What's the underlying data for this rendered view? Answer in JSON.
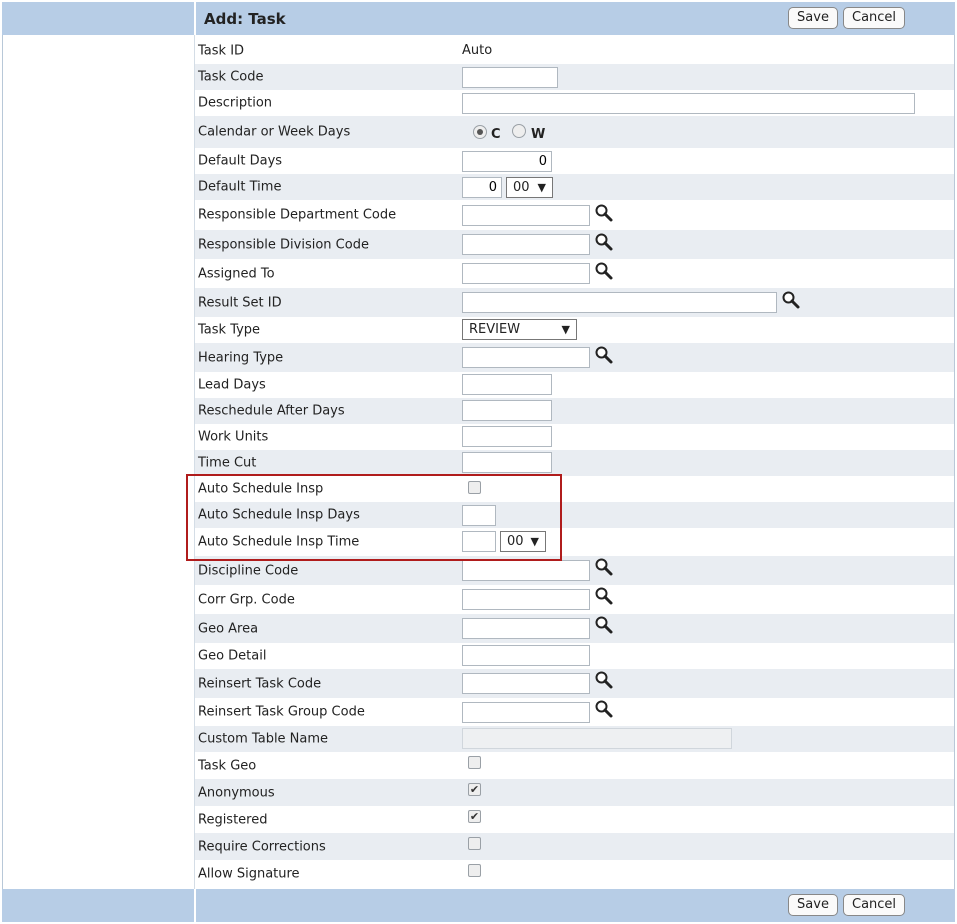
{
  "header": {
    "title": "Add: Task",
    "save_label": "Save",
    "cancel_label": "Cancel"
  },
  "footer": {
    "save_label": "Save",
    "cancel_label": "Cancel"
  },
  "form": {
    "task_id": {
      "label": "Task ID",
      "value": "Auto"
    },
    "task_code": {
      "label": "Task Code",
      "value": ""
    },
    "description": {
      "label": "Description",
      "value": ""
    },
    "calendar_or_week": {
      "label": "Calendar or Week Days",
      "option_c": "C",
      "option_w": "W",
      "selected": "C"
    },
    "default_days": {
      "label": "Default Days",
      "value": "0"
    },
    "default_time": {
      "label": "Default Time",
      "hours": "0",
      "minutes": "00"
    },
    "responsible_department_code": {
      "label": "Responsible Department Code",
      "value": ""
    },
    "responsible_division_code": {
      "label": "Responsible Division Code",
      "value": ""
    },
    "assigned_to": {
      "label": "Assigned To",
      "value": ""
    },
    "result_set_id": {
      "label": "Result Set ID",
      "value": ""
    },
    "task_type": {
      "label": "Task Type",
      "value": "REVIEW"
    },
    "hearing_type": {
      "label": "Hearing Type",
      "value": ""
    },
    "lead_days": {
      "label": "Lead Days",
      "value": ""
    },
    "reschedule_after_days": {
      "label": "Reschedule After Days",
      "value": ""
    },
    "work_units": {
      "label": "Work Units",
      "value": ""
    },
    "time_cut": {
      "label": "Time Cut",
      "value": ""
    },
    "auto_schedule_insp": {
      "label": "Auto Schedule Insp",
      "checked": false
    },
    "auto_schedule_insp_days": {
      "label": "Auto Schedule Insp Days",
      "value": ""
    },
    "auto_schedule_insp_time": {
      "label": "Auto Schedule Insp Time",
      "hours": "",
      "minutes": "00"
    },
    "discipline_code": {
      "label": "Discipline Code",
      "value": ""
    },
    "corr_grp_code": {
      "label": "Corr Grp. Code",
      "value": ""
    },
    "geo_area": {
      "label": "Geo Area",
      "value": ""
    },
    "geo_detail": {
      "label": "Geo Detail",
      "value": ""
    },
    "reinsert_task_code": {
      "label": "Reinsert Task Code",
      "value": ""
    },
    "reinsert_task_group_code": {
      "label": "Reinsert Task Group Code",
      "value": ""
    },
    "custom_table_name": {
      "label": "Custom Table Name",
      "value": ""
    },
    "task_geo": {
      "label": "Task Geo",
      "checked": false
    },
    "anonymous": {
      "label": "Anonymous",
      "checked": true
    },
    "registered": {
      "label": "Registered",
      "checked": true
    },
    "require_corrections": {
      "label": "Require Corrections",
      "checked": false
    },
    "allow_signature": {
      "label": "Allow Signature",
      "checked": false
    }
  },
  "icons": {
    "lookup": "search-icon",
    "dropdown": "triangle-down",
    "check": "checkmark"
  },
  "colors": {
    "header_bar": "#b7cde6",
    "alt_row": "#e9edf2",
    "highlight_border": "#b01c1c"
  }
}
